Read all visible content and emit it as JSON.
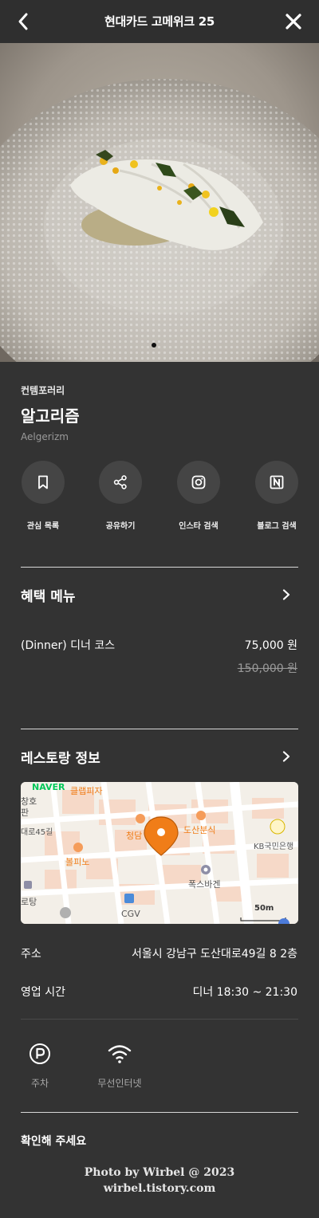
{
  "header": {
    "title": "현대카드 고메위크 25",
    "back_icon": "back-chevron-icon",
    "close_icon": "close-icon"
  },
  "restaurant": {
    "category": "컨템포러리",
    "name": "알고리즘",
    "name_en": "Aelgerizm"
  },
  "actions": [
    {
      "label": "관심 목록",
      "icon": "bookmark-icon"
    },
    {
      "label": "공유하기",
      "icon": "share-icon"
    },
    {
      "label": "인스타 검색",
      "icon": "instagram-icon"
    },
    {
      "label": "블로그 검색",
      "icon": "naver-blog-icon"
    }
  ],
  "benefit_menu": {
    "title": "혜택 메뉴",
    "item": {
      "name": "(Dinner)  디너 코스",
      "price": "75,000 원",
      "original_price": "150,000 원"
    }
  },
  "restaurant_info": {
    "title": "레스토랑 정보",
    "map": {
      "provider": "NAVER",
      "scale": "50m",
      "labels": [
        "클랩피자",
        "창호",
        "판",
        "대로45길",
        "청담",
        "도산분식",
        "KB국민은행",
        "볼피노",
        "폭스바겐",
        "로탕",
        "CGV"
      ]
    },
    "address_label": "주소",
    "address_value": "서울시 강남구 도산대로49길 8 2층",
    "hours_label": "영업 시간",
    "hours_value": "디너 18:30 ~ 21:30"
  },
  "amenities": [
    {
      "label": "주차",
      "icon": "parking-icon"
    },
    {
      "label": "무선인터넷",
      "icon": "wifi-icon"
    }
  ],
  "notice": "확인해 주세요",
  "watermark": {
    "line1": "Photo by Wirbel @ 2023",
    "line2": "wirbel.tistory.com"
  },
  "colors": {
    "background": "#333333",
    "divider": "#d8d8d8",
    "map_pin": "#f07d18",
    "naver_green": "#03c75a"
  }
}
